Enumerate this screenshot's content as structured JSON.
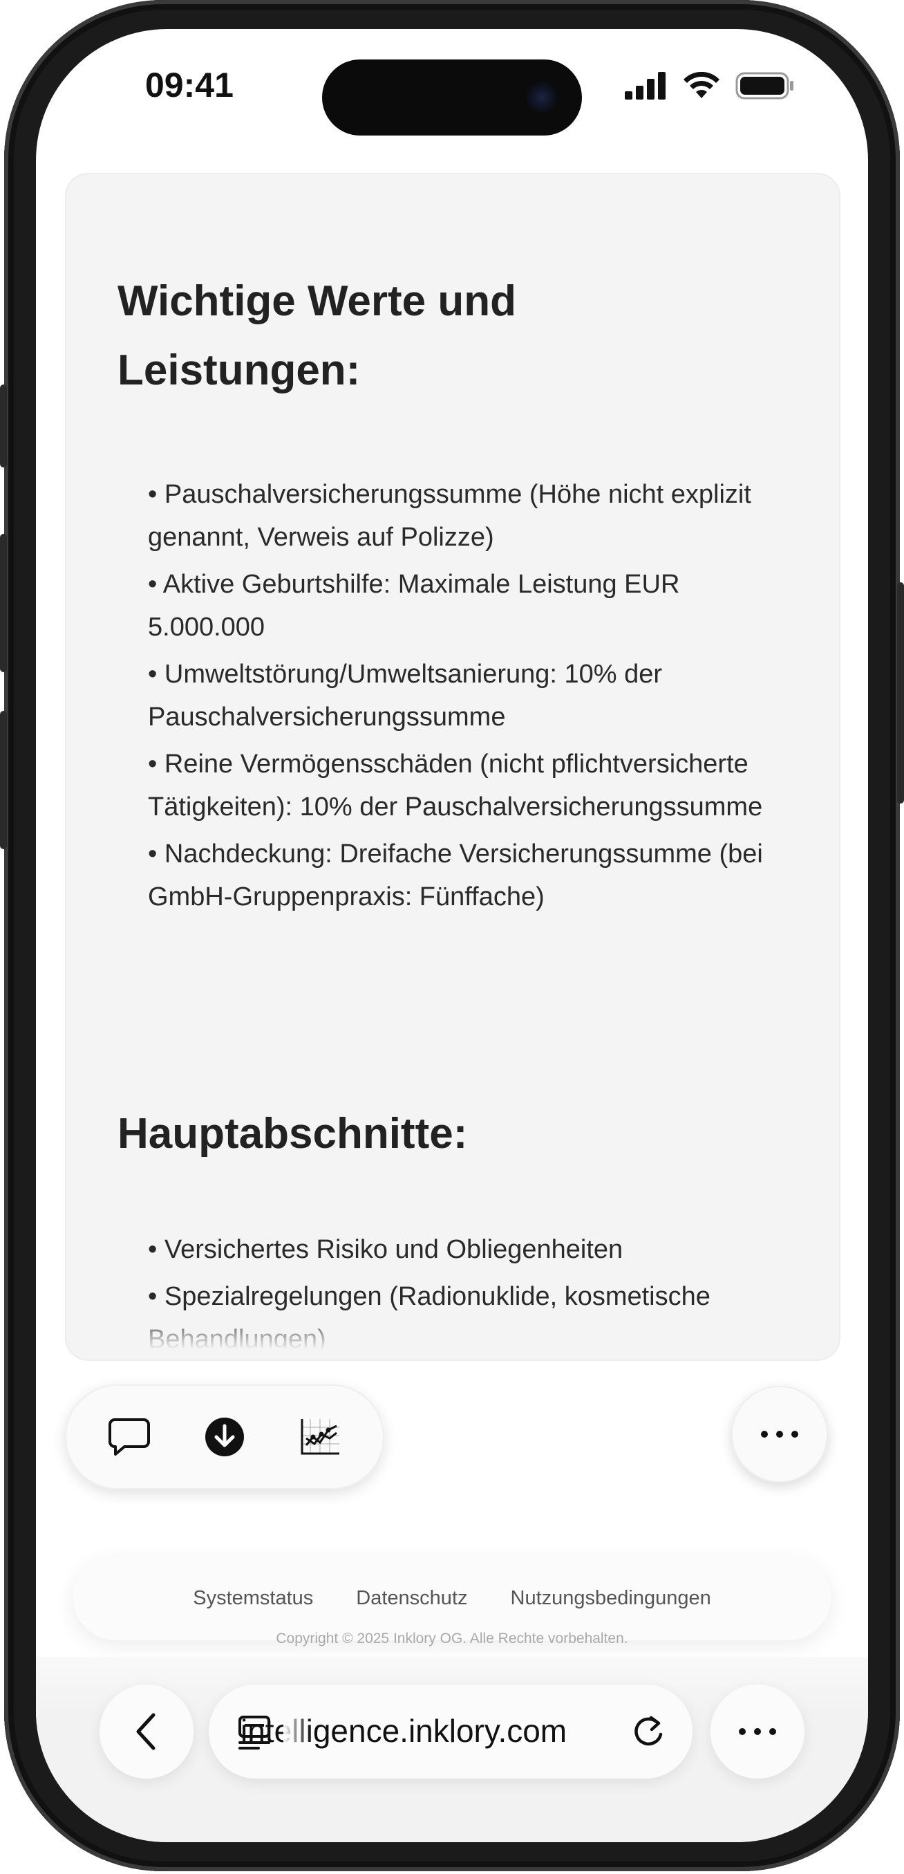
{
  "status_bar": {
    "time": "09:41"
  },
  "card": {
    "section1_title_line1": "Wichtige Werte und",
    "section1_title_line2": "Leistungen:",
    "values": [
      "Pauschalversicherungssumme (Höhe nicht explizit genannt, Verweis auf Polizze)",
      "Aktive Geburtshilfe: Maximale Leistung EUR 5.000.000",
      "Umweltstörung/Umweltsanierung: 10% der Pauschalversicherungssumme",
      "Reine Vermögensschäden (nicht pflichtversicherte Tätigkeiten): 10% der Pauschalversicherungssumme",
      "Nachdeckung: Dreifache Versicherungssumme (bei GmbH-Gruppenpraxis: Fünffache)"
    ],
    "section2_title": "Hauptabschnitte:",
    "sections": [
      "Versichertes Risiko und Obliegenheiten",
      "Spezialregelungen (Radionuklide, kosmetische Behandlungen)"
    ]
  },
  "actions": {
    "icons": [
      "chat-bubble-icon",
      "download-icon",
      "chart-icon"
    ],
    "more_icon": "ellipsis-icon"
  },
  "footer": {
    "links": [
      "Systemstatus",
      "Datenschutz",
      "Nutzungsbedingungen"
    ],
    "copyright": "Copyright © 2025 Inklory OG. Alle Rechte vorbehalten."
  },
  "browser": {
    "url": "intelligence.inklory.com",
    "back_icon": "chevron-left-icon",
    "tabs_icon": "tabs-icon",
    "reload_icon": "reload-icon",
    "menu_icon": "ellipsis-icon"
  }
}
